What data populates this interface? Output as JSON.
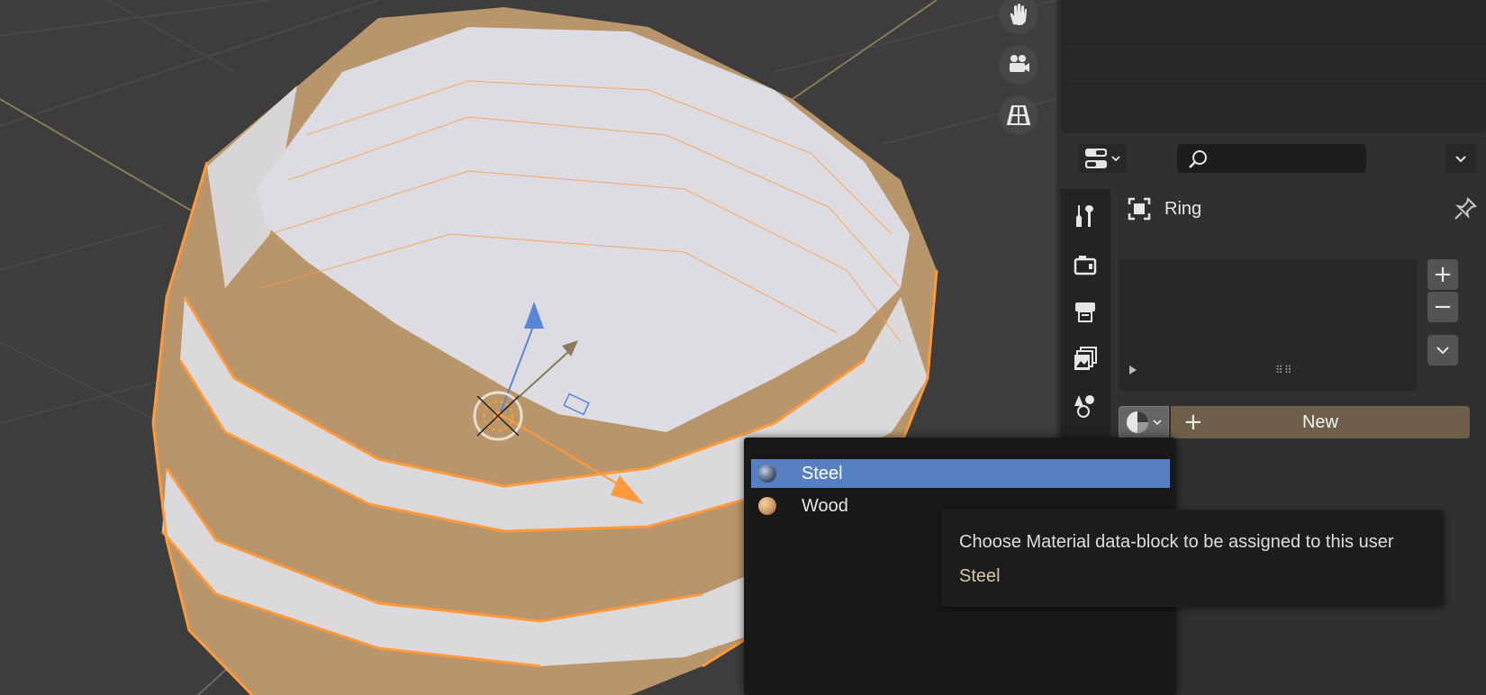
{
  "viewport": {
    "navigation_icons": [
      "hand-pan-icon",
      "camera-icon",
      "grid-ortho-icon"
    ],
    "scene_object": "ring barrel with orange selection outline",
    "colors": {
      "background": "#3d3d3d",
      "wood": "#b8956a",
      "selection": "#ff9a3c",
      "inner": "#dcdce2"
    }
  },
  "properties": {
    "header": {
      "editor_type_icon": "properties-editor-icon",
      "search_placeholder": "",
      "search_icon": "search-icon",
      "options_icon": "chevron-down-icon"
    },
    "tabs": [
      "tool-icon",
      "render-icon",
      "output-icon",
      "view-layer-icon",
      "scene-icon"
    ],
    "object_row": {
      "icon": "mesh-object-icon",
      "name": "Ring",
      "pin_icon": "pin-icon"
    },
    "slot_list": {
      "add_label": "+",
      "remove_label": "−",
      "menu_icon": "chevron-down-icon"
    },
    "material": {
      "browse_icon": "material-sphere-icon",
      "new_plus": "+",
      "new_label": "New"
    }
  },
  "dropdown": {
    "items": [
      {
        "label": "Steel",
        "selected": true,
        "color": "#6a7c9c"
      },
      {
        "label": "Wood",
        "selected": false,
        "color": "#c9935f"
      }
    ]
  },
  "tooltip": {
    "description": "Choose Material data-block to be assigned to this user",
    "value": "Steel"
  }
}
